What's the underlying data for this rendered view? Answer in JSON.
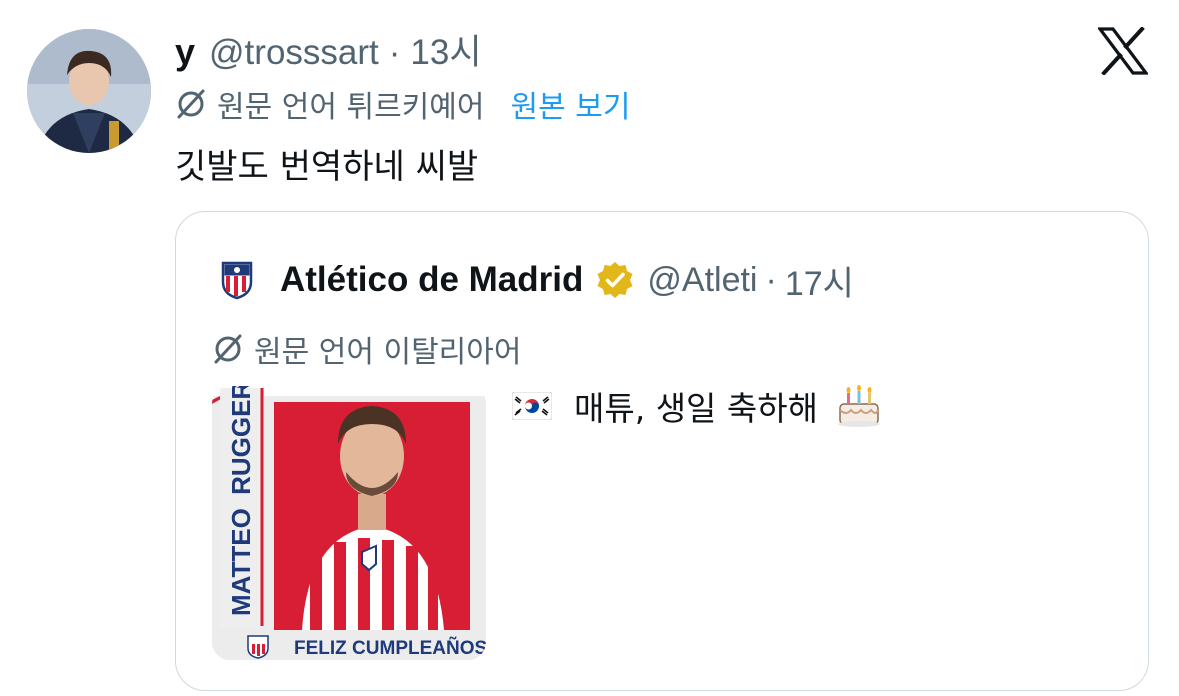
{
  "tweet": {
    "author_name": "y",
    "author_handle": "@trosssart",
    "separator": "·",
    "time": "13시",
    "translation_label": "원문 언어 튀르키예어",
    "show_original_label": "원본 보기",
    "text": "깃발도 번역하네 씨발"
  },
  "quote": {
    "author_name": "Atlético de Madrid",
    "author_handle": "@Atleti",
    "separator": "·",
    "time": "17시",
    "translation_label": "원문 언어 이탈리아어",
    "text": "매튜, 생일 축하해",
    "image": {
      "player_name_first": "MATTEO",
      "player_name_last": "RUGGERI",
      "caption": "FELIZ CUMPLEAÑOS"
    }
  },
  "icons": {
    "brand": "x-logo-icon",
    "translate": "translate-icon",
    "verified": "verified-badge-icon",
    "club": "atletico-crest-icon",
    "flag": "south-korea-flag-icon",
    "cake": "birthday-cake-icon"
  },
  "colors": {
    "text_primary": "#0f1419",
    "text_secondary": "#536471",
    "link": "#1d9bf0",
    "verified_gold": "#e2b719",
    "card_border": "#cfd9de",
    "atletico_red": "#d81e34"
  }
}
